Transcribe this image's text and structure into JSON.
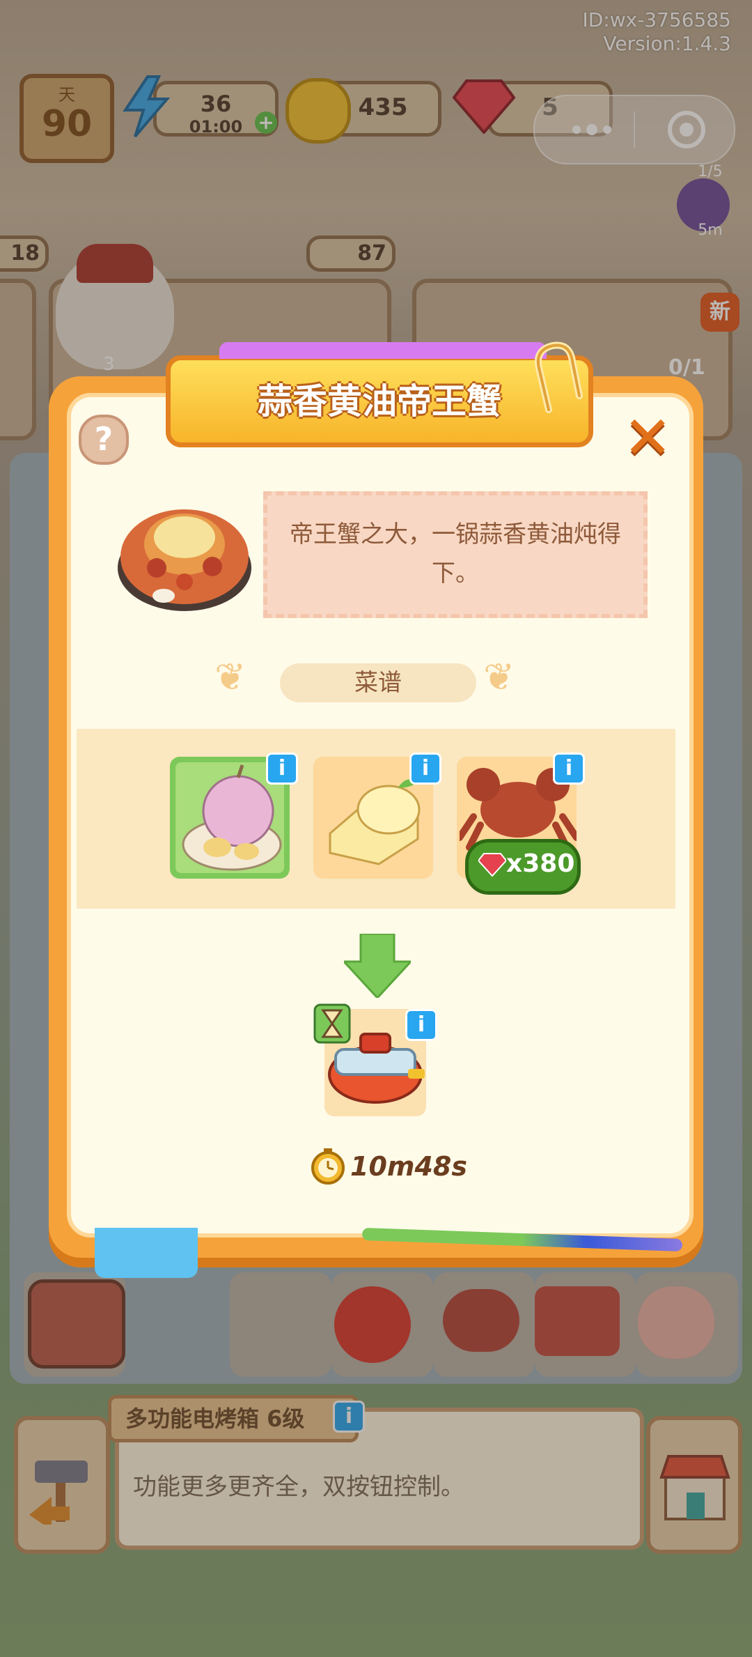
{
  "system": {
    "id_label": "ID:wx-3756585",
    "version_label": "Version:1.4.3"
  },
  "hud": {
    "day_label": "天",
    "day_value": "90",
    "energy_value": "36",
    "energy_timer": "01:00",
    "coins_value": "435",
    "gems_value": "5",
    "quest_progress": "1/5",
    "quest_timer": "5m",
    "left_counter": "18",
    "center_counter": "87",
    "bubble_count": "3",
    "order_badge": "0/1",
    "new_badge": "新"
  },
  "modal": {
    "title": "蒜香黄油帝王蟹",
    "description": "帝王蟹之大，一锅蒜香黄油炖得下。",
    "recipe_label": "菜谱",
    "crab_price": "x380",
    "timer": "10m48s",
    "info_glyph": "i",
    "help_glyph": "?",
    "close_glyph": "✕"
  },
  "ingredients": [
    {
      "name": "garlic",
      "selected": true
    },
    {
      "name": "butter",
      "selected": false
    },
    {
      "name": "king-crab",
      "selected": false
    }
  ],
  "bottom": {
    "appliance_title": "多功能电烤箱 6级",
    "appliance_desc": "功能更多更齐全，双按钮控制。"
  },
  "colors": {
    "modal_orange": "#f6a23a",
    "modal_cream": "#fffbe9",
    "info_blue": "#28a6f0",
    "selected_green": "#7cc95a",
    "price_green": "#4c9a2a"
  }
}
